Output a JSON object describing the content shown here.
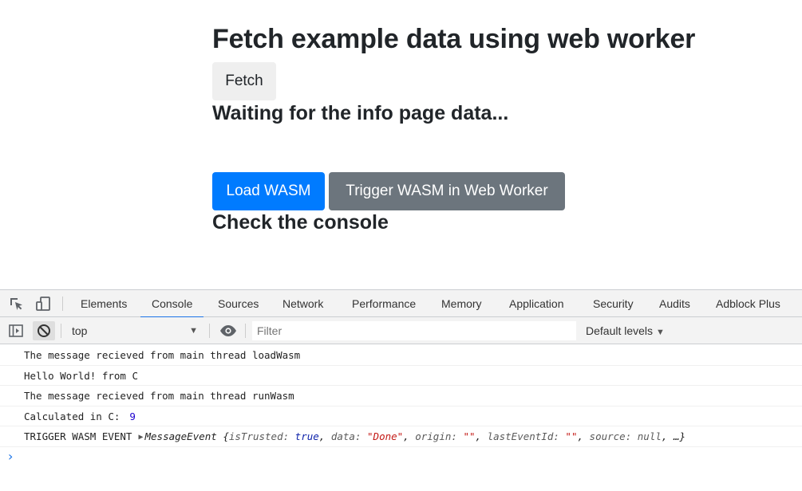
{
  "page": {
    "title": "Fetch example data using web worker",
    "fetch_button": "Fetch",
    "status_fetch": "Waiting for the info page data...",
    "load_wasm_button": "Load WASM",
    "trigger_wasm_button": "Trigger WASM in Web Worker",
    "status_wasm": "Check the console"
  },
  "devtools": {
    "tabs": [
      "Elements",
      "Console",
      "Sources",
      "Network",
      "Performance",
      "Memory",
      "Application",
      "Security",
      "Audits",
      "Adblock Plus"
    ],
    "active_tab": "Console",
    "context": "top",
    "filter_placeholder": "Filter",
    "levels": "Default levels",
    "console": {
      "line1": "The message recieved from main thread loadWasm",
      "line2": "Hello World! from C",
      "line3": "The message recieved from main thread runWasm",
      "line4_label": "Calculated in C:",
      "line4_value": "9",
      "line5_label": "TRIGGER WASM EVENT",
      "line5_obj_name": "MessageEvent",
      "line5_k1": "isTrusted:",
      "line5_v1": "true",
      "line5_k2": "data:",
      "line5_v2": "\"Done\"",
      "line5_k3": "origin:",
      "line5_v3": "\"\"",
      "line5_k4": "lastEventId:",
      "line5_v4": "\"\"",
      "line5_k5": "source:",
      "line5_v5": "null",
      "line5_tail": "…}"
    }
  },
  "colors": {
    "primary": "#007bff",
    "secondary": "#6c757d",
    "devtools_accent": "#1a73e8"
  }
}
